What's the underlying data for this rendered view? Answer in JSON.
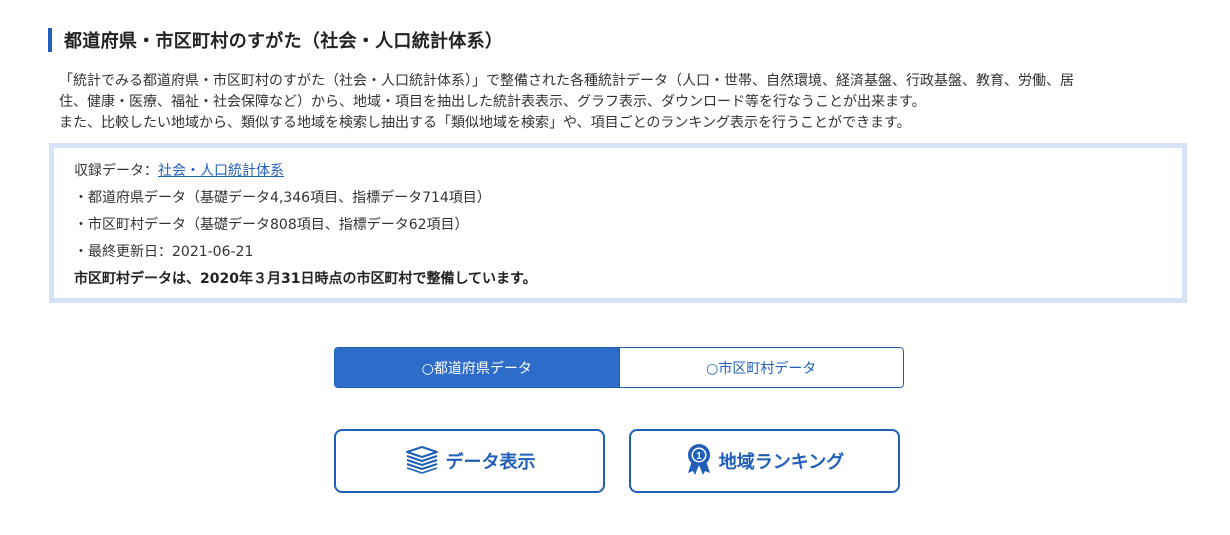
{
  "colors": {
    "accent": "#1f5fb8",
    "accent_active": "#2d6cc9",
    "box_border": "#d6e2f5",
    "text": "#333333"
  },
  "header": {
    "title": "都道府県・市区町村のすがた（社会・人口統計体系）"
  },
  "intro": {
    "line1": "「統計でみる都道府県・市区町村のすがた（社会・人口統計体系）」で整備された各種統計データ（人口・世帯、自然環境、経済基盤、行政基盤、教育、労働、居",
    "line2": "住、健康・医療、福祉・社会保障など）から、地域・項目を抽出した統計表表示、グラフ表示、ダウンロード等を行なうことが出来ます。",
    "line3": "また、比較したい地域から、類似する地域を検索し抽出する「類似地域を検索」や、項目ごとのランキング表示を行うことができます。"
  },
  "info": {
    "source_label": "収録データ：",
    "source_link": "社会・人口統計体系",
    "pref_data": "・都道府県データ（基礎データ4,346項目、指標データ714項目）",
    "muni_data": "・市区町村データ（基礎データ808項目、指標データ62項目）",
    "last_updated": "・最終更新日：2021-06-21",
    "note": "市区町村データは、2020年３月31日時点の市区町村で整備しています。"
  },
  "toggle": {
    "options": [
      "○都道府県データ",
      "○市区町村データ"
    ],
    "selected": "○都道府県データ"
  },
  "actions": {
    "data_display": {
      "label": "データ表示",
      "icon": "layers-icon"
    },
    "ranking": {
      "label": "地域ランキング",
      "icon": "award-ribbon-icon"
    }
  }
}
